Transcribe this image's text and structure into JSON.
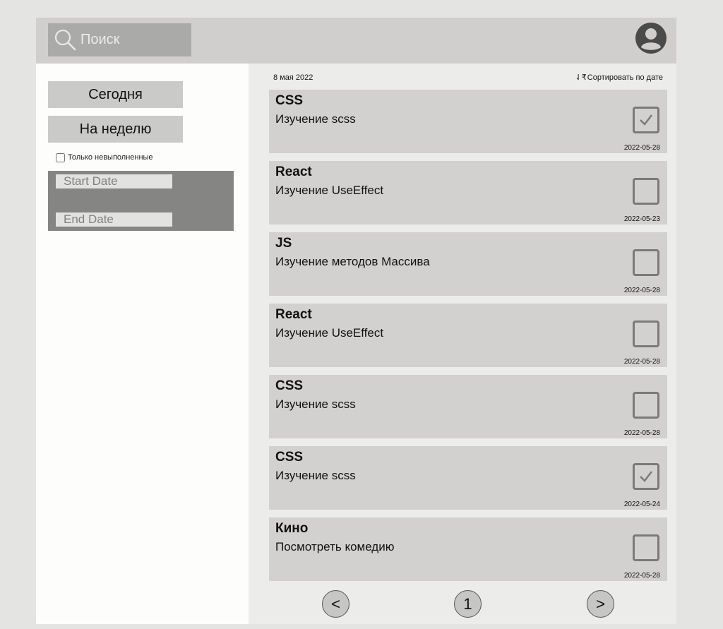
{
  "header": {
    "search_placeholder": "Поиск"
  },
  "sidebar": {
    "today_label": "Сегодня",
    "week_label": "На неделю",
    "only_incomplete_label": "Только невыполненные",
    "start_date_placeholder": "Start Date",
    "end_date_placeholder": "End Date"
  },
  "main": {
    "date_heading": "8 мая 2022",
    "sort_icon": "⇃₹",
    "sort_label": "Сортировать по дате"
  },
  "tasks": [
    {
      "title": "CSS",
      "desc": "Изучение scss",
      "done": true,
      "date": "2022-05-28"
    },
    {
      "title": "React",
      "desc": "Изучение UseEffect",
      "done": false,
      "date": "2022-05-23"
    },
    {
      "title": "JS",
      "desc": "Изучение методов Массива",
      "done": false,
      "date": "2022-05-28"
    },
    {
      "title": "React",
      "desc": "Изучение UseEffect",
      "done": false,
      "date": "2022-05-28"
    },
    {
      "title": "CSS",
      "desc": "Изучение scss",
      "done": false,
      "date": "2022-05-28"
    },
    {
      "title": "CSS",
      "desc": "Изучение scss",
      "done": true,
      "date": "2022-05-24"
    },
    {
      "title": "Кино",
      "desc": "Посмотреть комедию",
      "done": false,
      "date": "2022-05-28"
    }
  ],
  "pagination": {
    "prev_label": "<",
    "page_label": "1",
    "next_label": ">"
  },
  "icons": {
    "search": "search-icon",
    "avatar": "user-avatar-icon",
    "check": "checkmark-icon"
  }
}
